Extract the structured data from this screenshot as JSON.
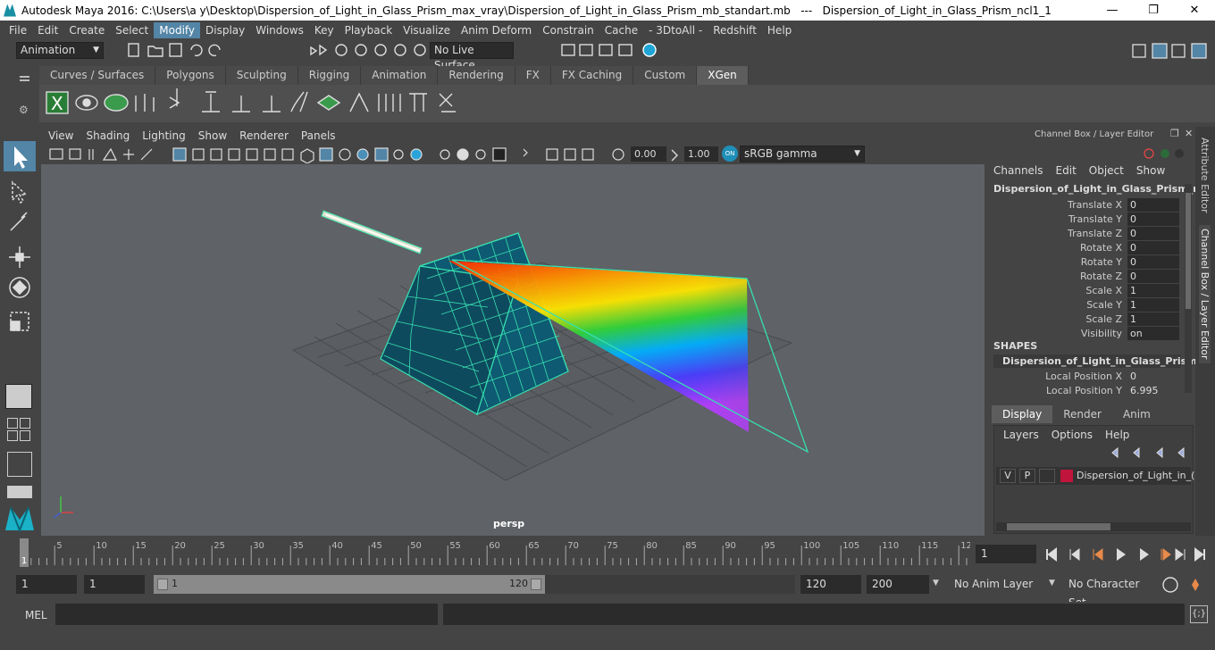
{
  "title": "Autodesk Maya 2016: C:\\Users\\a y\\Desktop\\Dispersion_of_Light_in_Glass_Prism_max_vray\\Dispersion_of_Light_in_Glass_Prism_mb_standart.mb   ---   Dispersion_of_Light_in_Glass_Prism_ncl1_1",
  "window_buttons": {
    "minimize": "—",
    "restore": "❐",
    "close": "✕"
  },
  "menus": [
    "File",
    "Edit",
    "Create",
    "Select",
    "Modify",
    "Display",
    "Windows",
    "Key",
    "Playback",
    "Visualize",
    "Anim Deform",
    "Constrain",
    "Cache",
    "- 3DtoAll -",
    "Redshift",
    "Help"
  ],
  "active_menu": "Modify",
  "status": {
    "mode": "Animation",
    "live_surface": "No Live Surface"
  },
  "shelf_tabs": [
    "Curves / Surfaces",
    "Polygons",
    "Sculpting",
    "Rigging",
    "Animation",
    "Rendering",
    "FX",
    "FX Caching",
    "Custom",
    "XGen"
  ],
  "active_shelf": "XGen",
  "viewport": {
    "menus": [
      "View",
      "Shading",
      "Lighting",
      "Show",
      "Renderer",
      "Panels"
    ],
    "exposure": "0.00",
    "gamma": "1.00",
    "colorspace": "sRGB gamma",
    "camera_label": "persp"
  },
  "channel_box": {
    "header": "Channel Box / Layer Editor",
    "menus": [
      "Channels",
      "Edit",
      "Object",
      "Show"
    ],
    "object_name": "Dispersion_of_Light_in_Glass_Prism_n...",
    "attributes": [
      {
        "name": "Translate X",
        "value": "0"
      },
      {
        "name": "Translate Y",
        "value": "0"
      },
      {
        "name": "Translate Z",
        "value": "0"
      },
      {
        "name": "Rotate X",
        "value": "0"
      },
      {
        "name": "Rotate Y",
        "value": "0"
      },
      {
        "name": "Rotate Z",
        "value": "0"
      },
      {
        "name": "Scale X",
        "value": "1"
      },
      {
        "name": "Scale Y",
        "value": "1"
      },
      {
        "name": "Scale Z",
        "value": "1"
      },
      {
        "name": "Visibility",
        "value": "on"
      }
    ],
    "shapes_label": "SHAPES",
    "shape_name": "Dispersion_of_Light_in_Glass_Prism_...",
    "shape_attributes": [
      {
        "name": "Local Position X",
        "value": "0"
      },
      {
        "name": "Local Position Y",
        "value": "6.995"
      }
    ],
    "layer_tabs": [
      "Display",
      "Render",
      "Anim"
    ],
    "active_layer_tab": "Display",
    "layer_menus": [
      "Layers",
      "Options",
      "Help"
    ],
    "layer": {
      "v": "V",
      "p": "P",
      "name": "Dispersion_of_Light_in_(",
      "color": "#c0143c"
    }
  },
  "side_tabs": [
    "Attribute Editor",
    "Channel Box / Layer Editor"
  ],
  "timeline": {
    "ticks": [
      "5",
      "10",
      "15",
      "20",
      "25",
      "30",
      "35",
      "40",
      "45",
      "50",
      "55",
      "60",
      "65",
      "70",
      "75",
      "80",
      "85",
      "90",
      "95",
      "100",
      "105",
      "110",
      "115",
      "12"
    ],
    "start_marker": "1",
    "current_frame": "1"
  },
  "range": {
    "start": "1",
    "playback_start": "1",
    "slider_start": "1",
    "slider_end": "120",
    "playback_end": "120",
    "end": "200",
    "anim_layer": "No Anim Layer",
    "character_set": "No Character Set"
  },
  "cmd": {
    "label": "MEL"
  },
  "accent": "#5285a6",
  "wire_color": "#37e0b0"
}
